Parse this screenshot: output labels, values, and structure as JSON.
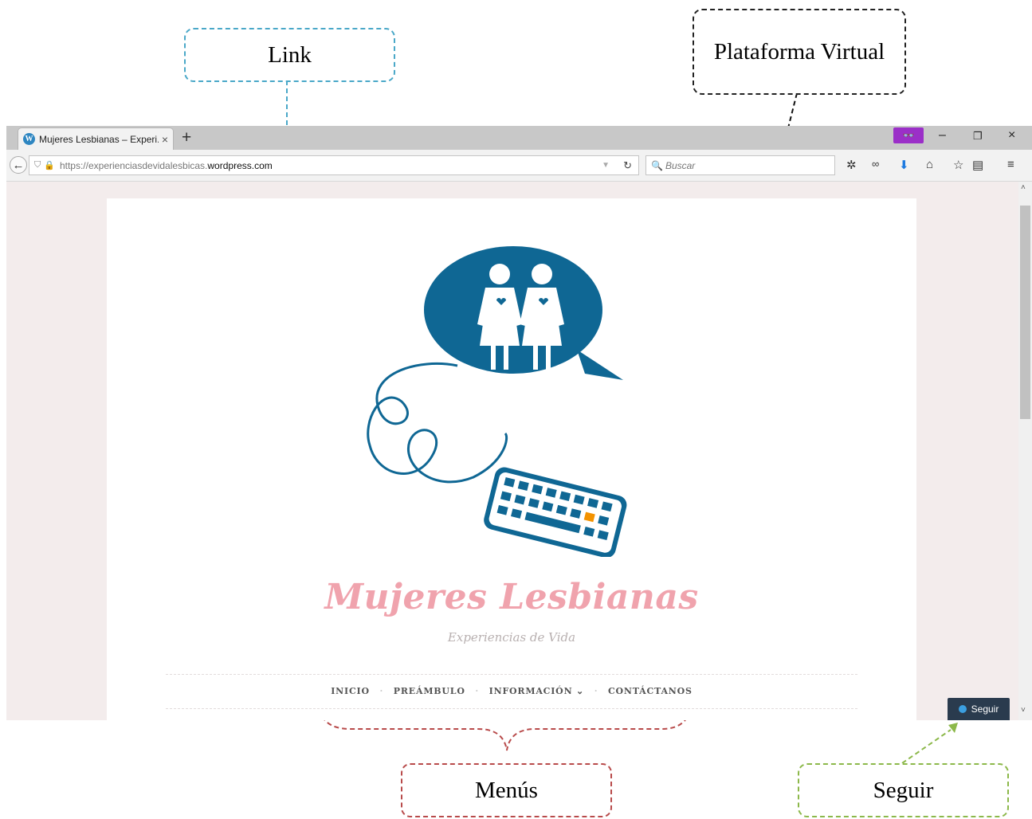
{
  "annotations": {
    "link": "Link",
    "plataforma": "Plataforma Virtual",
    "menus": "Menús",
    "seguir": "Seguir"
  },
  "browser": {
    "tab_title": "Mujeres Lesbianas – Experi...",
    "tab_close": "×",
    "new_tab": "+",
    "url_prefix": "https://experienciasdevidalesbicas.",
    "url_domain": "wordpress.com",
    "search_placeholder": "Buscar",
    "window_controls": [
      "–",
      "❐",
      "×"
    ]
  },
  "site": {
    "title": "Mujeres Lesbianas",
    "tagline": "Experiencias de Vida",
    "menu": [
      "INICIO",
      "PREÁMBULO",
      "INFORMACIÓN ⌄",
      "CONTÁCTANOS"
    ],
    "menu_separator": "·",
    "follow_button": "Seguir"
  },
  "colors": {
    "title": "#f0a3ad",
    "logo_blue": "#0f6794",
    "key_accent": "#f39200",
    "follow_bg": "#2a3b4e",
    "annotation_link": "#4aa8c8",
    "annotation_menus": "#b84a4a",
    "annotation_seguir": "#8cb84a"
  },
  "icons": [
    "wordpress-icon",
    "back-arrow-icon",
    "shield-icon",
    "lock-icon",
    "reload-icon",
    "search-icon",
    "gear-icon",
    "mask-icon",
    "download-icon",
    "home-icon",
    "star-icon",
    "reading-list-icon",
    "menu-icon"
  ]
}
